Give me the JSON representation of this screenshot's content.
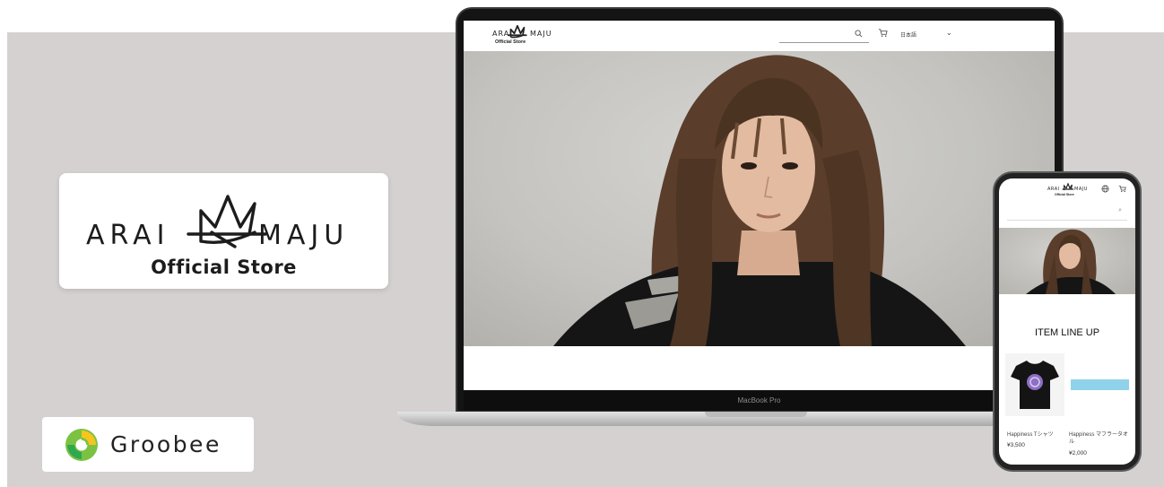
{
  "brand": {
    "logo_left": "ARAI",
    "logo_right": "MAJU",
    "logo_subtitle": "Official Store"
  },
  "partner": {
    "name": "Groobee",
    "icon": "groobee-swirl-icon",
    "colors": [
      "#7cc242",
      "#f7c51e",
      "#2fa84f"
    ]
  },
  "laptop": {
    "model_label": "MacBook Pro",
    "header": {
      "logo_left": "ARAI",
      "logo_right": "MAJU",
      "logo_subtitle": "Official Store",
      "search_icon": "search-icon",
      "cart_icon": "cart-icon",
      "language": "日本語",
      "language_chevron": "chevron-down-icon"
    }
  },
  "phone": {
    "header": {
      "logo_left": "ARAI",
      "logo_right": "MAJU",
      "logo_subtitle": "Official Store",
      "globe_icon": "globe-icon",
      "cart_icon": "cart-icon"
    },
    "search_icon": "search-icon",
    "section_title": "ITEM LINE UP",
    "products": [
      {
        "name": "Happiness Tシャツ",
        "price": "¥3,500"
      },
      {
        "name": "Happiness マフラータオル",
        "price": "¥2,000"
      }
    ]
  }
}
